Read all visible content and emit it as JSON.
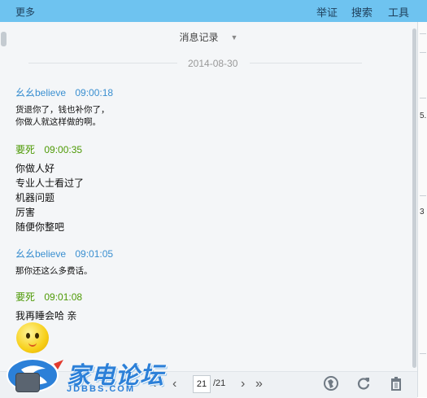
{
  "topbar": {
    "more_label": "更多",
    "menu": [
      "举证",
      "搜索",
      "工具"
    ]
  },
  "history": {
    "title": "消息记录",
    "date": "2014-08-30"
  },
  "messages": [
    {
      "sender": "幺幺believe",
      "time": "09:00:18",
      "color": "#3a8fd0",
      "lines": [
        "货退你了，钱也补你了，",
        "你做人就这样做的啊。"
      ]
    },
    {
      "sender": "要死",
      "time": "09:00:35",
      "color": "#4e9a06",
      "lines": [
        "你做人好",
        "专业人士看过了",
        "机器问题",
        "厉害",
        "随便你整吧"
      ]
    },
    {
      "sender": "幺幺believe",
      "time": "09:01:05",
      "color": "#3a8fd0",
      "lines": [
        "那你还这么多费话。"
      ]
    },
    {
      "sender": "要死",
      "time": "09:01:08",
      "color": "#4e9a06",
      "lines": [
        "我再睡会哈 亲"
      ]
    }
  ],
  "pagination": {
    "current": "21",
    "total": "/21"
  },
  "watermark": {
    "brand": "家电论坛",
    "site": "JDBBS.COM"
  },
  "right_edge_fragments": [
    "5.",
    "3"
  ]
}
